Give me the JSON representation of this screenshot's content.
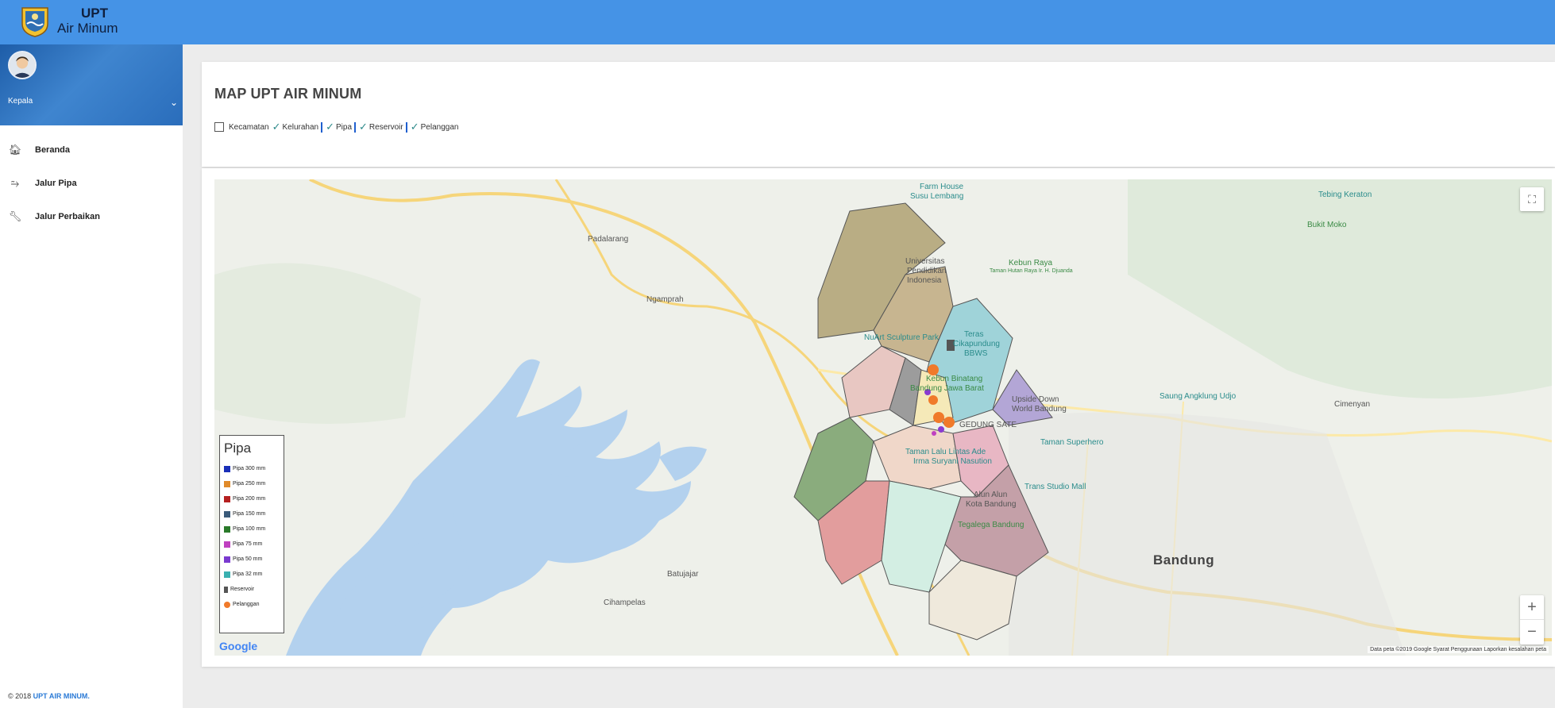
{
  "brand": {
    "line1": "UPT",
    "line2": "Air Minum"
  },
  "user": {
    "name": "Kepala"
  },
  "menu": [
    {
      "label": "Beranda",
      "icon": "home-icon"
    },
    {
      "label": "Jalur Pipa",
      "icon": "pipe-route-icon"
    },
    {
      "label": "Jalur Perbaikan",
      "icon": "wrench-icon"
    }
  ],
  "footer": {
    "prefix": "© 2018",
    "link": "UPT AIR MINUM."
  },
  "page": {
    "title": "MAP UPT AIR MINUM"
  },
  "layers": [
    {
      "label": "Kecamatan",
      "checked": false
    },
    {
      "label": "Kelurahan",
      "checked": true
    },
    {
      "label": "Pipa",
      "checked": true
    },
    {
      "label": "Reservoir",
      "checked": true
    },
    {
      "label": "Pelanggan",
      "checked": true
    }
  ],
  "legend": {
    "title": "Pipa",
    "items": [
      {
        "label": "Pipa 300 mm",
        "color": "#1a2fb8"
      },
      {
        "label": "Pipa 250 mm",
        "color": "#e08a2a"
      },
      {
        "label": "Pipa 200 mm",
        "color": "#b52020"
      },
      {
        "label": "Pipa 150 mm",
        "color": "#3a5a7a"
      },
      {
        "label": "Pipa 100 mm",
        "color": "#2a7a2a"
      },
      {
        "label": "Pipa 75 mm",
        "color": "#c040c0"
      },
      {
        "label": "Pipa 50 mm",
        "color": "#7a3ad0"
      },
      {
        "label": "Pipa 32 mm",
        "color": "#3ab0b0"
      },
      {
        "label": "Reservoir",
        "color": "#555555"
      },
      {
        "label": "Pelanggan",
        "color": "#f07a2a"
      }
    ]
  },
  "map": {
    "labels": {
      "padalarang": "Padalarang",
      "ngamprah": "Ngamprah",
      "batujajar": "Batujajar",
      "cihampelas": "Cihampelas",
      "bandung": "Bandung",
      "cimenyan": "Cimenyan",
      "farm_house": "Farm House",
      "susu_lembang": "Susu Lembang",
      "tebing_keraton": "Tebing Keraton",
      "bukit_moko": "Bukit Moko",
      "univ1": "Universitas",
      "univ2": "Pendidikan",
      "univ3": "Indonesia",
      "kebun_raya": "Kebun Raya",
      "kebun_raya_sub": "Taman Hutan Raya Ir. H. Djuanda",
      "nuart": "NuArt Sculpture Park",
      "teras1": "Teras",
      "teras2": "Cikapundung",
      "teras3": "BBWS",
      "kebun_binatang1": "Kebun Binatang",
      "kebun_binatang2": "Bandung Jawa Barat",
      "upside1": "Upside Down",
      "upside2": "World Bandung",
      "saung": "Saung Angklung Udjo",
      "gedung_sate": "GEDUNG SATE",
      "taman_superhero": "Taman Superhero",
      "taman_lalu1": "Taman Lalu Lintas Ade",
      "taman_lalu2": "Irma Suryani Nasution",
      "alun1": "Alun Alun",
      "alun2": "Kota Bandung",
      "trans_studio": "Trans Studio Mall",
      "tegalega": "Tegalega Bandung"
    },
    "google": "Google",
    "attribution": "Data peta ©2019 Google   Syarat Penggunaan   Laporkan kesalahan peta",
    "zoom_in": "+",
    "zoom_out": "−",
    "fullscreen": "⛶"
  }
}
